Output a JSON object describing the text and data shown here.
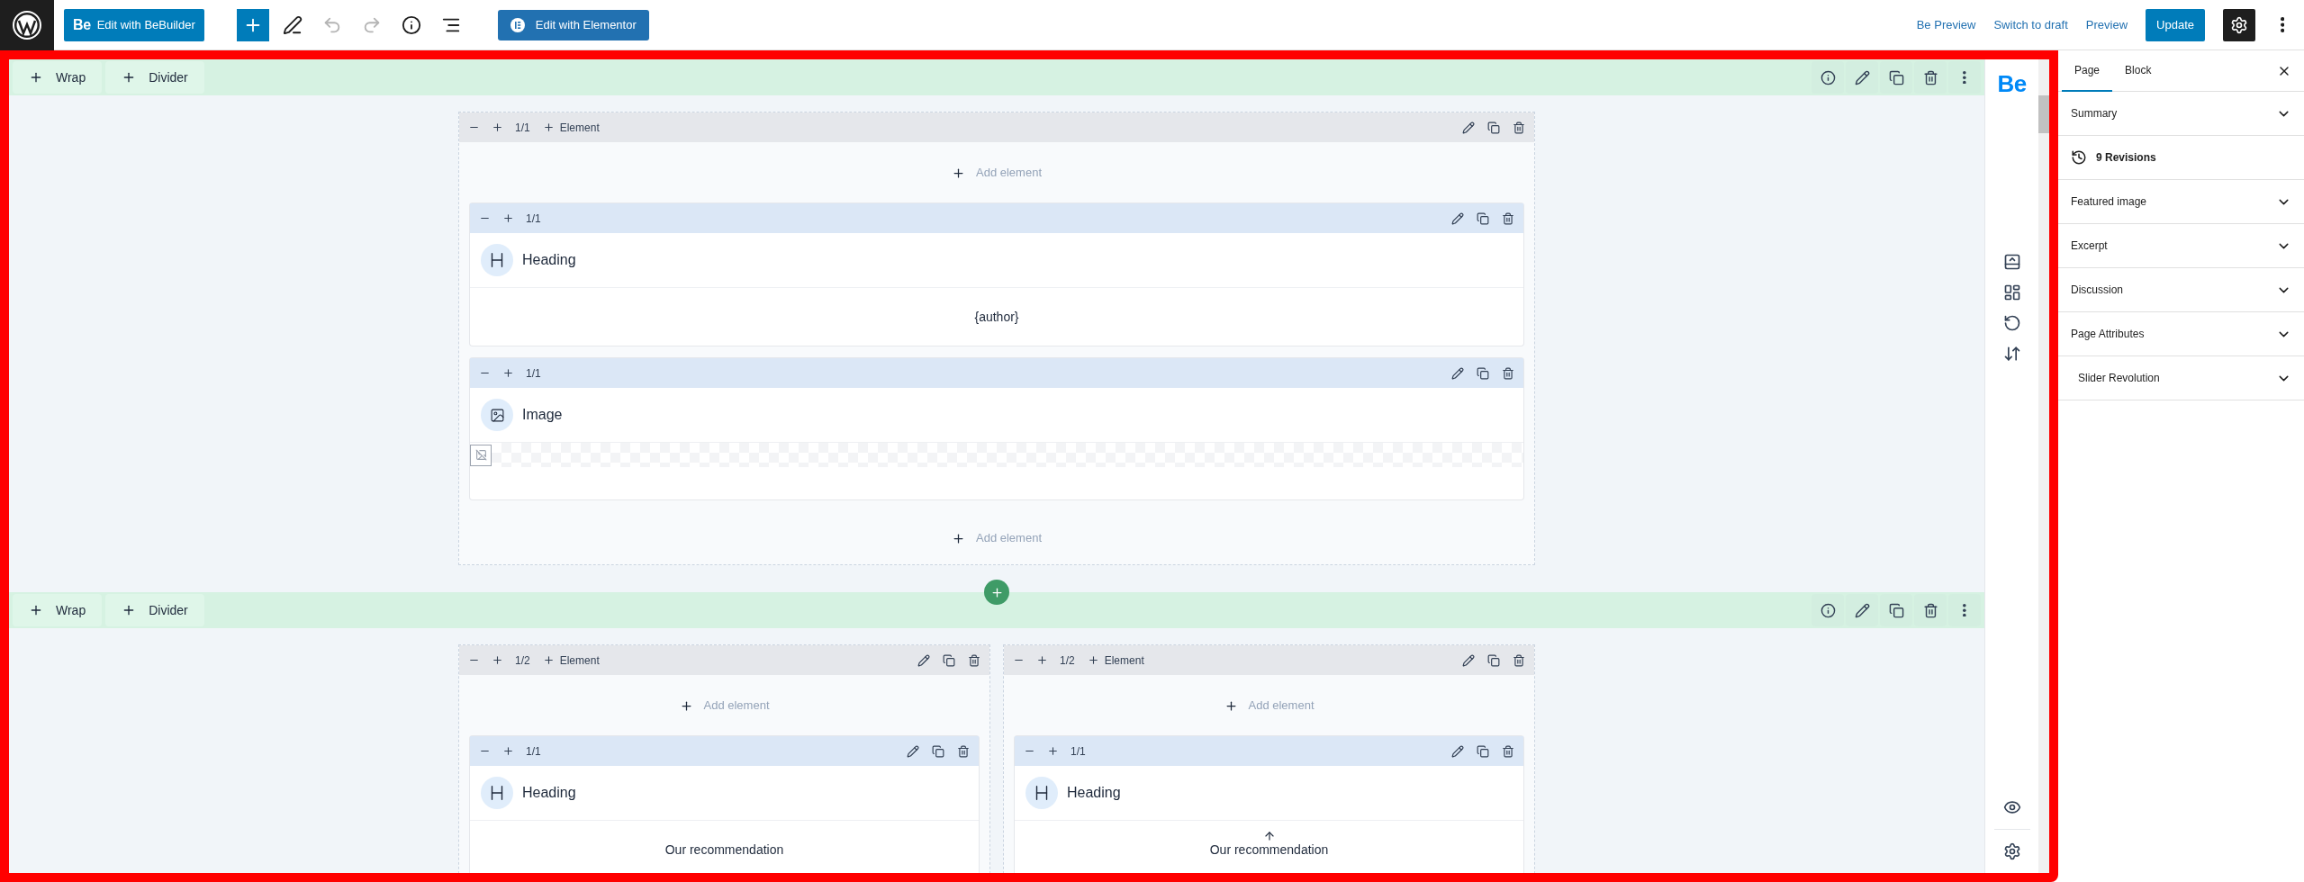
{
  "topbar": {
    "bebuilder_button": {
      "logo": "Be",
      "label": "Edit with BeBuilder"
    },
    "tools": [
      {
        "kind": "add",
        "disabled": false
      },
      {
        "kind": "pen",
        "disabled": false
      },
      {
        "kind": "undo",
        "disabled": true
      },
      {
        "kind": "redo",
        "disabled": true
      },
      {
        "kind": "info",
        "disabled": false
      },
      {
        "kind": "list",
        "disabled": false
      }
    ],
    "elementor_button": "Edit with Elementor",
    "links": [
      "Be Preview",
      "Switch to draft",
      "Preview"
    ],
    "update_button": "Update"
  },
  "sections": [
    {
      "buttons": [
        "Wrap",
        "Divider"
      ],
      "columns": [
        {
          "size": "1/1",
          "add_label": "Element",
          "add_top": "Add element",
          "add_bottom": "Add element",
          "items": [
            {
              "kind": "heading",
              "size": "1/1",
              "title": "Heading",
              "content": "{author}",
              "arrow": false
            },
            {
              "kind": "image",
              "size": "1/1",
              "title": "Image",
              "arrow": false
            }
          ]
        }
      ]
    },
    {
      "buttons": [
        "Wrap",
        "Divider"
      ],
      "columns": [
        {
          "size": "1/2",
          "add_label": "Element",
          "add_top": "Add element",
          "items": [
            {
              "kind": "heading",
              "size": "1/1",
              "title": "Heading",
              "content": "Our recommendation",
              "arrow": false
            }
          ]
        },
        {
          "size": "1/2",
          "add_label": "Element",
          "add_top": "Add element",
          "items": [
            {
              "kind": "heading",
              "size": "1/1",
              "title": "Heading",
              "content": "Our recommendation",
              "arrow": true
            }
          ]
        }
      ]
    }
  ],
  "tool_column": {
    "logo": "Be"
  },
  "sidebar": {
    "tabs": [
      {
        "label": "Page",
        "selected": true
      },
      {
        "label": "Block",
        "selected": false
      }
    ],
    "panels": [
      {
        "kind": "panel",
        "label": "Summary",
        "expanded": false
      },
      {
        "kind": "revisions",
        "label": "9 Revisions"
      },
      {
        "kind": "panel",
        "label": "Featured image",
        "expanded": false
      },
      {
        "kind": "panel",
        "label": "Excerpt",
        "expanded": false
      },
      {
        "kind": "panel",
        "label": "Discussion",
        "expanded": false
      },
      {
        "kind": "panel",
        "label": "Page Attributes",
        "expanded": false
      },
      {
        "kind": "panel",
        "label": "Slider Revolution",
        "expanded": false
      }
    ]
  }
}
